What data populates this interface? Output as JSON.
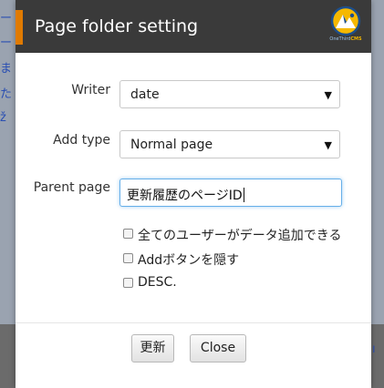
{
  "dialog": {
    "title": "Page folder setting",
    "logo": {
      "name": "OneThird CMS logo",
      "text_main": "OneThird",
      "text_accent": "CMS"
    },
    "fields": {
      "writer": {
        "label": "Writer",
        "value": "date"
      },
      "add_type": {
        "label": "Add type",
        "value": "Normal page"
      },
      "parent_page": {
        "label": "Parent page",
        "value": "更新履歴のページID"
      }
    },
    "checkboxes": [
      {
        "label": "全てのユーザーがデータ追加できる",
        "checked": false
      },
      {
        "label": "Addボタンを隠す",
        "checked": false
      },
      {
        "label": "DESC.",
        "checked": false
      }
    ],
    "buttons": {
      "update": "更新",
      "close": "Close"
    }
  },
  "colors": {
    "header_bg": "#3a3a3a",
    "accent": "#e07a00",
    "focus_border": "#66afe9"
  },
  "background_text": {
    "left": [
      "ー",
      "ー",
      "ま",
      "た",
      "ž"
    ],
    "right": "ı"
  }
}
